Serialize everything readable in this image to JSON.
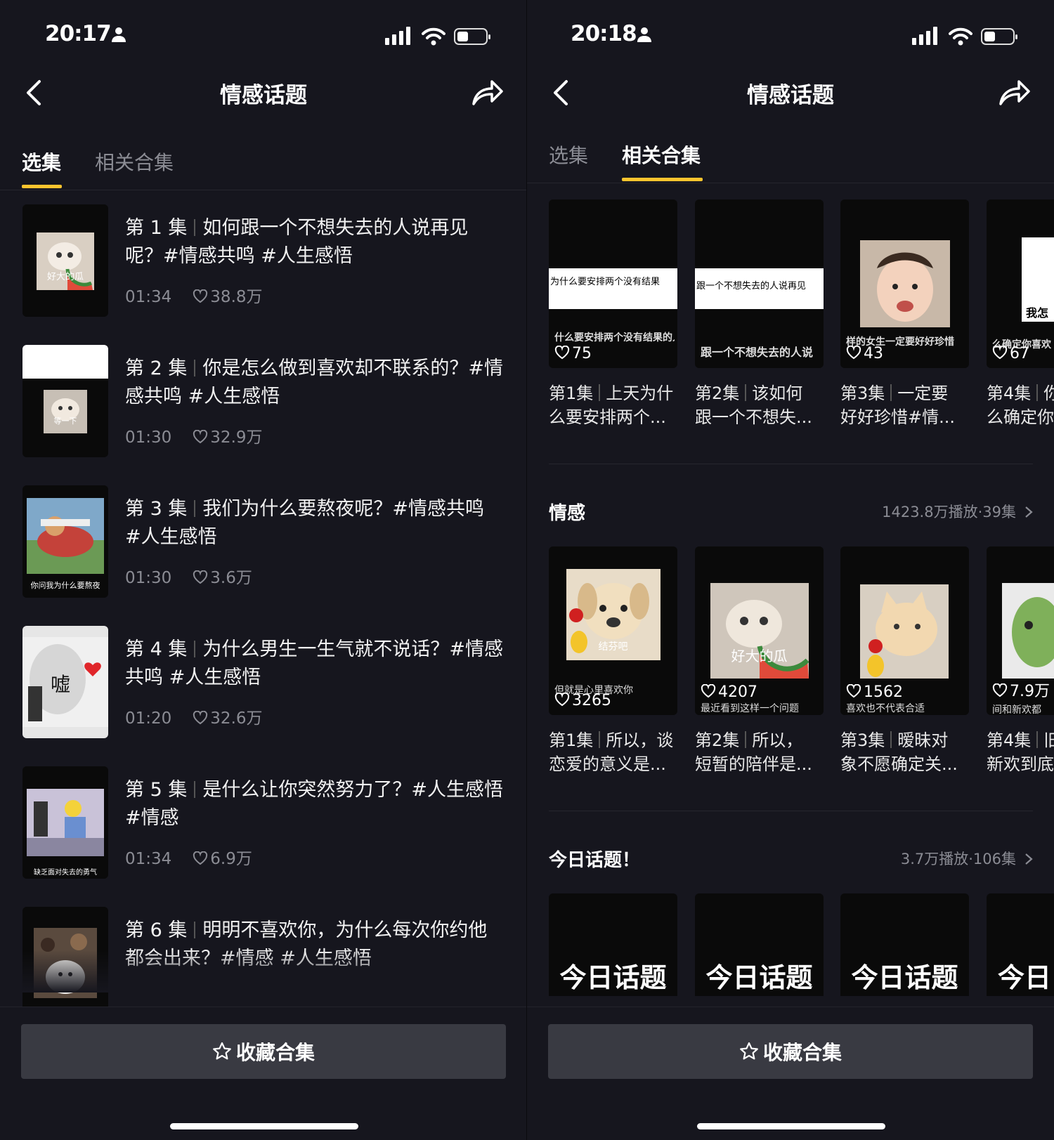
{
  "left": {
    "time": "20:17",
    "title": "情感话题",
    "tabs": [
      "选集",
      "相关合集"
    ],
    "episodes": [
      {
        "num": "第 1 集",
        "title": "如何跟一个不想失去的人说再见呢？#情感共鸣 #人生感悟",
        "duration": "01:34",
        "likes": "38.8万",
        "thumb_text": "好大的瓜"
      },
      {
        "num": "第 2 集",
        "title": "你是怎么做到喜欢却不联系的？#情感共鸣 #人生感悟",
        "duration": "01:30",
        "likes": "32.9万",
        "thumb_text": "等一下"
      },
      {
        "num": "第 3 集",
        "title": "我们为什么要熬夜呢？#情感共鸣 #人生感悟",
        "duration": "01:30",
        "likes": "3.6万",
        "thumb_text": "你问我为什么要熬夜"
      },
      {
        "num": "第 4 集",
        "title": "为什么男生一生气就不说话？#情感共鸣 #人生感悟",
        "duration": "01:20",
        "likes": "32.6万",
        "thumb_text": "嘘"
      },
      {
        "num": "第 5 集",
        "title": "是什么让你突然努力了？#人生感悟 #情感",
        "duration": "01:34",
        "likes": "6.9万",
        "thumb_text": "缺乏面对失去的勇气"
      },
      {
        "num": "第 6 集",
        "title": "明明不喜欢你，为什么每次你约他都会出来？#情感 #人生感悟",
        "duration": "",
        "likes": "",
        "thumb_text": ""
      }
    ],
    "fav_label": "收藏合集"
  },
  "right": {
    "time": "20:18",
    "title": "情感话题",
    "tabs": [
      "选集",
      "相关合集"
    ],
    "row1": [
      {
        "likes": "75",
        "overlay": "为什么要安排两个没有结果",
        "bottom_text": "什么要安排两个没有结果的人",
        "title1": "第1集",
        "title2": "上天为什",
        "title3": "么要安排两个..."
      },
      {
        "likes": "",
        "overlay": "跟一个不想失去的人说再见",
        "bottom_text": "跟一个不想失去的人说",
        "title1": "第2集",
        "title2": "该如何",
        "title3": "跟一个不想失..."
      },
      {
        "likes": "43",
        "overlay": "",
        "bottom_text": "样的女生一定要好好珍惜",
        "title1": "第3集",
        "title2": "一定要",
        "title3": "好好珍惜#情..."
      },
      {
        "likes": "67",
        "overlay": "我怎",
        "bottom_text": "么确定你喜欢",
        "title1": "第4集",
        "title2": "你",
        "title3": "么确定你"
      }
    ],
    "section1": {
      "title": "情感",
      "meta": "1423.8万播放·39集"
    },
    "row2": [
      {
        "likes": "3265",
        "overlay": "结芬吧",
        "caption": "但就是心里喜欢你",
        "title1": "第1集",
        "title2": "所以，谈",
        "title3": "恋爱的意义是..."
      },
      {
        "likes": "4207",
        "overlay": "好大的瓜",
        "caption": "最近看到这样一个问题",
        "title1": "第2集",
        "title2": "所以，",
        "title3": "短暂的陪伴是..."
      },
      {
        "likes": "1562",
        "overlay": "",
        "caption": "喜欢也不代表合适",
        "title1": "第3集",
        "title2": "暧昧对",
        "title3": "象不愿确定关..."
      },
      {
        "likes": "7.9万",
        "overlay": "",
        "caption": "间和新欢都",
        "title1": "第4集",
        "title2": "旧",
        "title3": "新欢到底"
      }
    ],
    "section2": {
      "title": "今日话题！",
      "meta": "3.7万播放·106集"
    },
    "row3": [
      "今日话题",
      "今日话题",
      "今日话题",
      "今日"
    ],
    "fav_label": "收藏合集"
  },
  "icons": {
    "back": "back-chevron-icon",
    "share": "share-arrow-icon",
    "heart": "heart-icon",
    "star": "star-icon",
    "chevron": "chevron-right-icon"
  },
  "colors": {
    "bg": "#16161e",
    "accent": "#fec42e",
    "muted": "#8b8c94",
    "button": "#393a42"
  }
}
